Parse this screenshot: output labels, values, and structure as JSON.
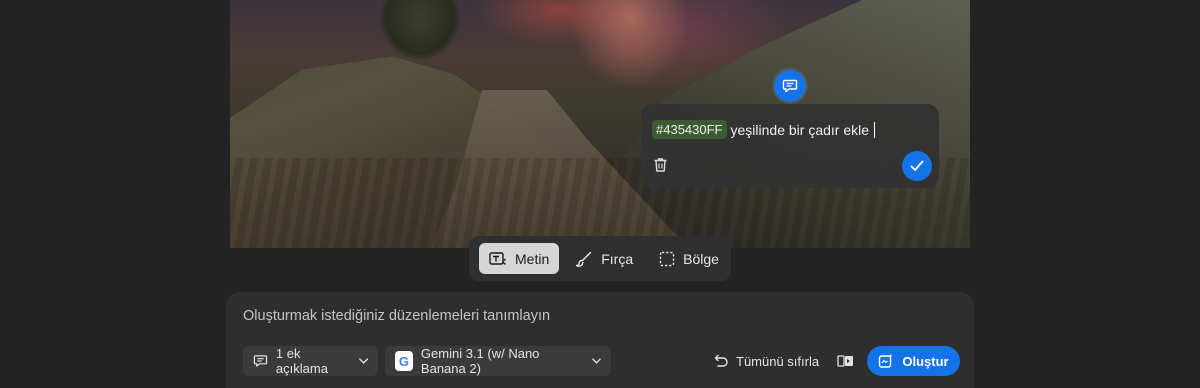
{
  "comment": {
    "color_token": "#435430FF",
    "text": "yeşilinde bir çadır ekle"
  },
  "tools": [
    {
      "label": "Metin",
      "icon": "text-tool-icon",
      "active": true
    },
    {
      "label": "Fırça",
      "icon": "brush-icon",
      "active": false
    },
    {
      "label": "Bölge",
      "icon": "selection-icon",
      "active": false
    }
  ],
  "prompt": {
    "placeholder": "Oluşturmak istediğiniz düzenlemeleri tanımlayın",
    "comments_label": "1 ek açıklama",
    "model_label": "Gemini 3.1 (w/ Nano Banana 2)",
    "reset_label": "Tümünü sıfırla",
    "generate_label": "Oluştur"
  },
  "colors": {
    "accent": "#1473e6",
    "background": "#232323",
    "token_bg": "#3d5a34"
  }
}
